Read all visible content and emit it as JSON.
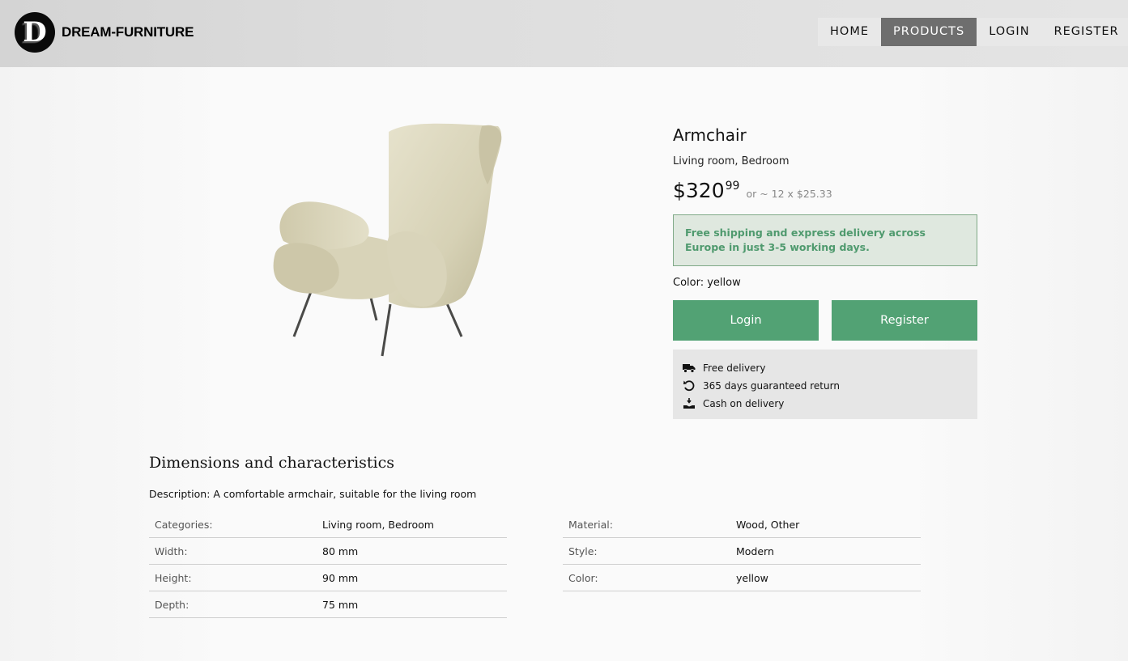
{
  "header": {
    "logo_letter": "D",
    "brand": "DREAM-FURNITURE",
    "nav": [
      {
        "label": "HOME",
        "active": false
      },
      {
        "label": "PRODUCTS",
        "active": true
      },
      {
        "label": "LOGIN",
        "active": false
      },
      {
        "label": "REGISTER",
        "active": false
      }
    ]
  },
  "product": {
    "title": "Armchair",
    "categories": "Living room, Bedroom",
    "price_main": "$320",
    "price_cents": "99",
    "price_installment": "or ~ 12 x $25.33",
    "shipping_note": "Free shipping and express delivery across Europe in just 3-5 working days.",
    "color_line": "Color: yellow",
    "login_button": "Login",
    "register_button": "Register",
    "perks": [
      {
        "icon": "truck-icon",
        "label": "Free delivery"
      },
      {
        "icon": "return-icon",
        "label": "365 days guaranteed return"
      },
      {
        "icon": "cash-hand-icon",
        "label": "Cash on delivery"
      }
    ]
  },
  "details": {
    "heading": "Dimensions and characteristics",
    "description": "Description: A comfortable armchair, suitable for the living room",
    "left_specs": [
      {
        "label": "Categories:",
        "value": "Living room, Bedroom"
      },
      {
        "label": "Width:",
        "value": "80 mm"
      },
      {
        "label": "Height:",
        "value": "90 mm"
      },
      {
        "label": "Depth:",
        "value": "75 mm"
      }
    ],
    "right_specs": [
      {
        "label": "Material:",
        "value": "Wood, Other"
      },
      {
        "label": "Style:",
        "value": "Modern"
      },
      {
        "label": "Color:",
        "value": "yellow"
      }
    ]
  },
  "colors": {
    "accent_green": "#52a274",
    "shipping_bg": "#dfe8df",
    "shipping_text": "#4f9a6e",
    "nav_active": "#6e6e6e"
  }
}
